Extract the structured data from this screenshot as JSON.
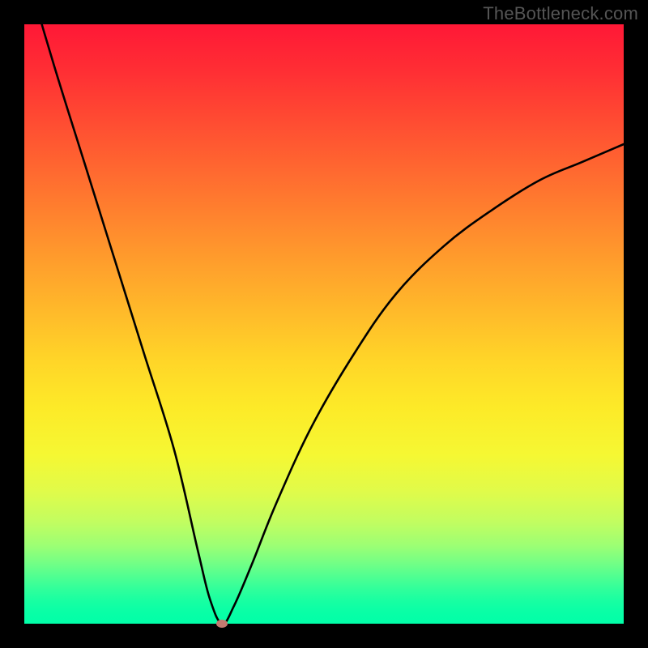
{
  "watermark": "TheBottleneck.com",
  "chart_data": {
    "type": "line",
    "title": "",
    "xlabel": "",
    "ylabel": "",
    "xlim": [
      0,
      100
    ],
    "ylim": [
      0,
      100
    ],
    "grid": false,
    "legend": false,
    "series": [
      {
        "name": "bottleneck-curve",
        "x": [
          0,
          5,
          10,
          15,
          20,
          25,
          29,
          31,
          33,
          35,
          38,
          42,
          48,
          55,
          62,
          70,
          78,
          86,
          93,
          100
        ],
        "values": [
          110,
          93,
          77,
          61,
          45,
          29,
          12,
          4,
          0,
          3,
          10,
          20,
          33,
          45,
          55,
          63,
          69,
          74,
          77,
          80
        ]
      }
    ],
    "marker": {
      "x": 33,
      "y": 0,
      "color": "#c47a70"
    },
    "gradient_stops": [
      {
        "pos": 0,
        "color": "#ff1836"
      },
      {
        "pos": 0.5,
        "color": "#ffd528"
      },
      {
        "pos": 0.78,
        "color": "#e0fb4a"
      },
      {
        "pos": 1.0,
        "color": "#02ffa8"
      }
    ]
  }
}
